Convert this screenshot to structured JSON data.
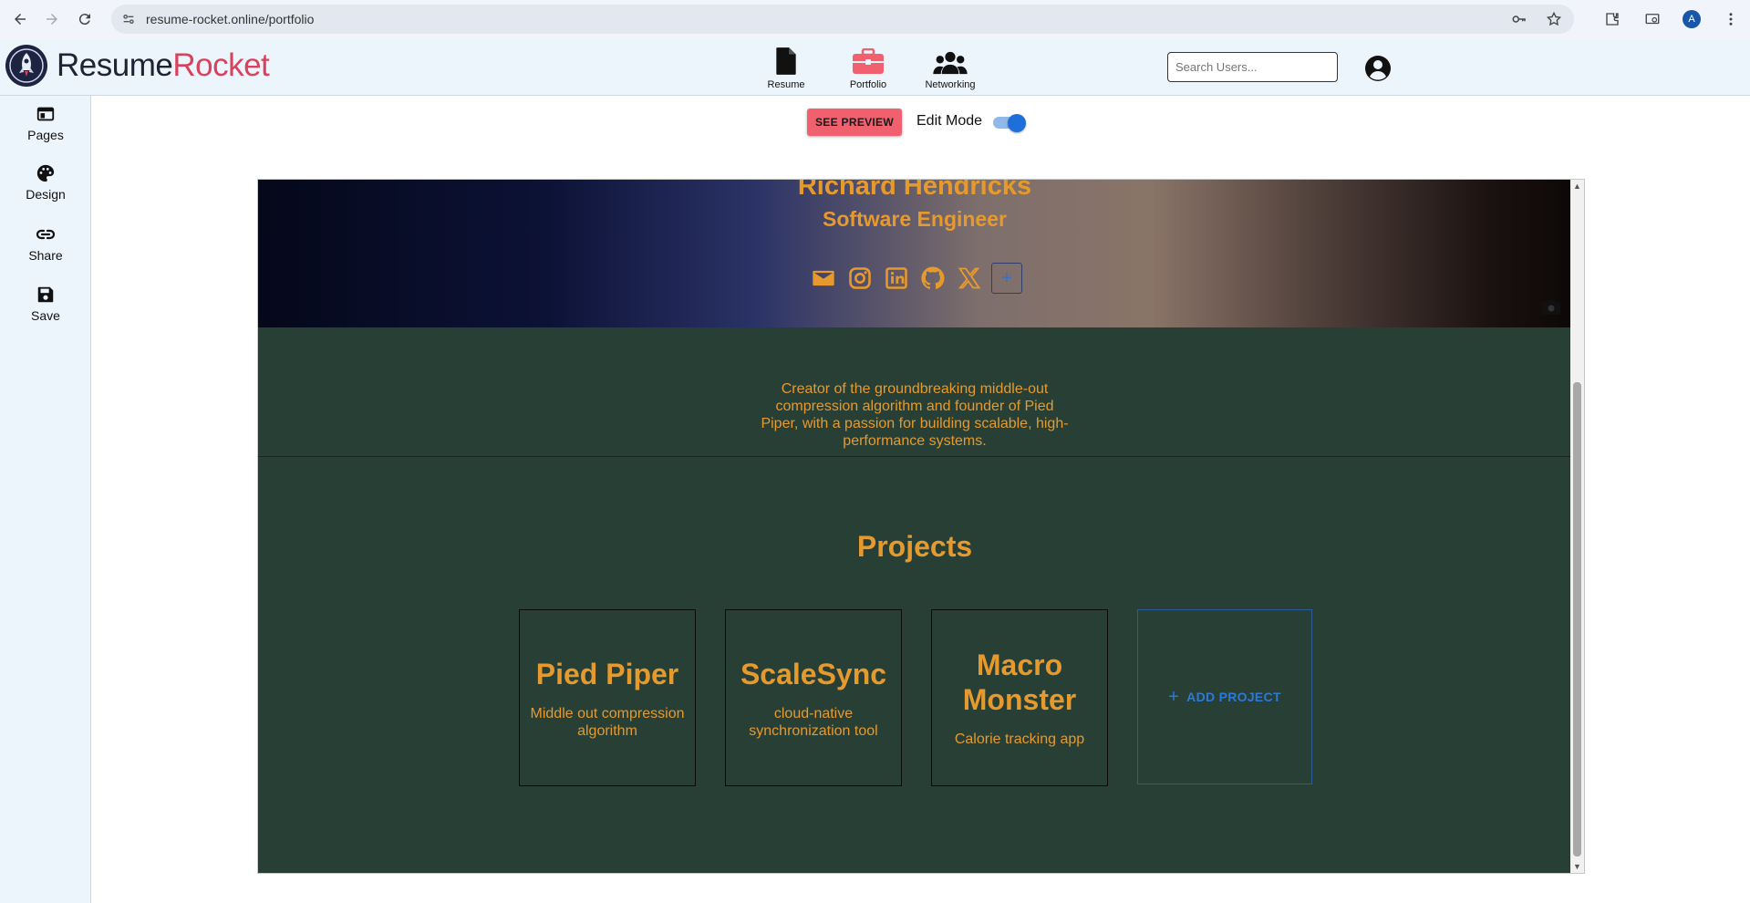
{
  "browser": {
    "url": "resume-rocket.online/portfolio",
    "profile_initial": "A",
    "icons": [
      "back-icon",
      "forward-icon",
      "reload-icon",
      "site-info-icon",
      "key-icon",
      "star-icon",
      "extensions-icon",
      "media-icon",
      "menu-icon"
    ]
  },
  "app": {
    "brand_part1": "Resume",
    "brand_part2": "Rocket",
    "nav": [
      {
        "label": "Resume",
        "icon": "document-icon"
      },
      {
        "label": "Portfolio",
        "icon": "briefcase-icon"
      },
      {
        "label": "Networking",
        "icon": "people-icon"
      }
    ],
    "search_placeholder": "Search Users...",
    "account_icon": "account-circle-icon"
  },
  "sidebar": {
    "items": [
      {
        "label": "Pages",
        "icon": "pages-icon"
      },
      {
        "label": "Design",
        "icon": "palette-icon"
      },
      {
        "label": "Share",
        "icon": "link-icon"
      },
      {
        "label": "Save",
        "icon": "save-icon"
      }
    ]
  },
  "editor": {
    "preview_label": "SEE PREVIEW",
    "edit_mode_label": "Edit Mode",
    "edit_mode_on": true
  },
  "portfolio": {
    "name": "Richard Hendricks",
    "role": "Software Engineer",
    "socials": [
      "email-icon",
      "instagram-icon",
      "linkedin-icon",
      "github-icon",
      "x-icon"
    ],
    "add_social": "+",
    "bio": "Creator of the groundbreaking middle-out compression algorithm and founder of Pied Piper, with a passion for building scalable, high-performance systems.",
    "projects_title": "Projects",
    "projects": [
      {
        "title": "Pied Piper",
        "desc": "Middle out compression algorithm"
      },
      {
        "title": "ScaleSync",
        "desc": "cloud-native synchronization tool"
      },
      {
        "title": "Macro Monster",
        "desc": "Calorie tracking app"
      }
    ],
    "add_project_label": "ADD PROJECT",
    "colors": {
      "accent": "#e69a2d",
      "background": "#283f36",
      "preview_button": "#f0606e",
      "link_blue": "#2c79d6"
    }
  }
}
